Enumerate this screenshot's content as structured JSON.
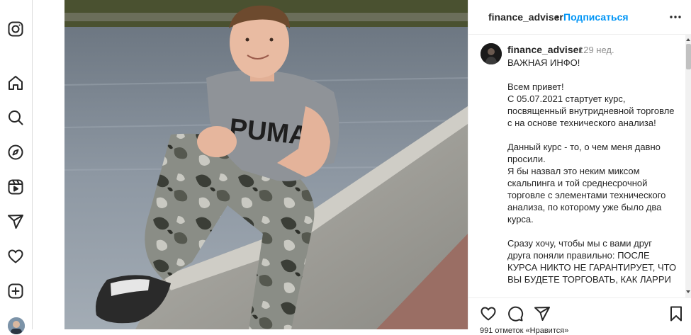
{
  "sidebar": {
    "items": [
      {
        "name": "instagram-icon"
      },
      {
        "name": "home-icon"
      },
      {
        "name": "search-icon"
      },
      {
        "name": "explore-icon"
      },
      {
        "name": "reels-icon"
      },
      {
        "name": "direct-messages-icon"
      },
      {
        "name": "notifications-heart-icon"
      },
      {
        "name": "create-icon"
      }
    ]
  },
  "post": {
    "username": "finance_adviser",
    "separator": "•",
    "follow_label": "Подписаться",
    "caption": {
      "username": "finance_adviser",
      "time": "129 нед.",
      "text": "ВАЖНАЯ ИНФО!\n\nВсем привет!\nС 05.07.2021 стартует курс, посвященный внутридневной торговле с на основе технического анализа!\n\nДанный курс - то, о чем меня давно просили.\nЯ бы назвал это неким миксом скальпинга и той средне­срочной торговле с элементами технического анализа, по которому уже было два курса.\n\nСразу хочу, чтобы мы с вами друг друга поняли правильно: ПОСЛЕ КУРСА НИКТО НЕ ГАРАНТИРУЕТ, ЧТО ВЫ БУДЕТЕ ТОРГОВАТЬ, КАК ЛАРРИ"
    },
    "footer_peek": "991 отметок «Нравится»"
  },
  "photo": {
    "shirt_text": "PUMA"
  },
  "colors": {
    "accent": "#0095f6",
    "text": "#262626",
    "muted": "#8e8e8e",
    "border": "#dbdbdb"
  }
}
